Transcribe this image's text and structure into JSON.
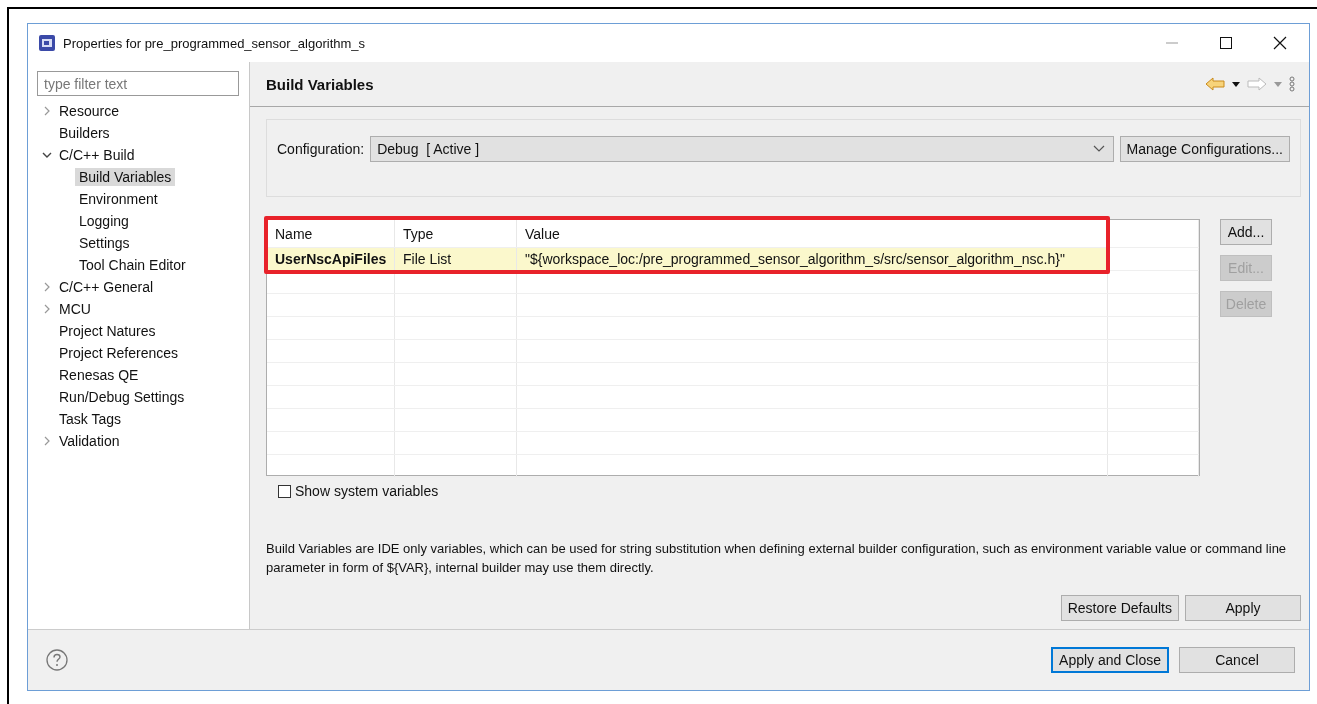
{
  "window": {
    "title": "Properties for pre_programmed_sensor_algorithm_s"
  },
  "filter": {
    "placeholder": "type filter text"
  },
  "sidebar": {
    "items": [
      {
        "label": "Resource",
        "expanded": false,
        "selected": false
      },
      {
        "label": "Builders",
        "selected": false
      },
      {
        "label": "C/C++ Build",
        "expanded": true,
        "selected": false,
        "children": [
          {
            "label": "Build Variables",
            "selected": true
          },
          {
            "label": "Environment",
            "selected": false
          },
          {
            "label": "Logging",
            "selected": false
          },
          {
            "label": "Settings",
            "selected": false
          },
          {
            "label": "Tool Chain Editor",
            "selected": false
          }
        ]
      },
      {
        "label": "C/C++ General",
        "expanded": false,
        "selected": false
      },
      {
        "label": "MCU",
        "expanded": false,
        "selected": false
      },
      {
        "label": "Project Natures",
        "selected": false
      },
      {
        "label": "Project References",
        "selected": false
      },
      {
        "label": "Renesas QE",
        "selected": false
      },
      {
        "label": "Run/Debug Settings",
        "selected": false
      },
      {
        "label": "Task Tags",
        "selected": false
      },
      {
        "label": "Validation",
        "expanded": false,
        "selected": false
      }
    ]
  },
  "page": {
    "title": "Build Variables"
  },
  "configuration": {
    "label": "Configuration:",
    "value": "Debug  [ Active ]",
    "manage_button": "Manage Configurations..."
  },
  "table": {
    "columns": [
      "Name",
      "Type",
      "Value"
    ],
    "rows": [
      {
        "name": "UserNscApiFiles",
        "type": "File List",
        "value": "\"${workspace_loc:/pre_programmed_sensor_algorithm_s/src/sensor_algorithm_nsc.h}\""
      }
    ]
  },
  "side_buttons": [
    {
      "label": "Add...",
      "disabled": false
    },
    {
      "label": "Edit...",
      "disabled": true
    },
    {
      "label": "Delete",
      "disabled": true
    }
  ],
  "show_system_variables": {
    "label": "Show system variables",
    "checked": false
  },
  "description": "Build Variables are IDE only variables, which can be used for string substitution when defining external builder configuration, such as environment variable value or command line parameter in form of ${VAR}, internal builder may use them directly.",
  "page_buttons": [
    "Restore Defaults",
    "Apply"
  ],
  "dialog_buttons": [
    {
      "label": "Apply and Close",
      "default": true
    },
    {
      "label": "Cancel",
      "default": false
    }
  ]
}
